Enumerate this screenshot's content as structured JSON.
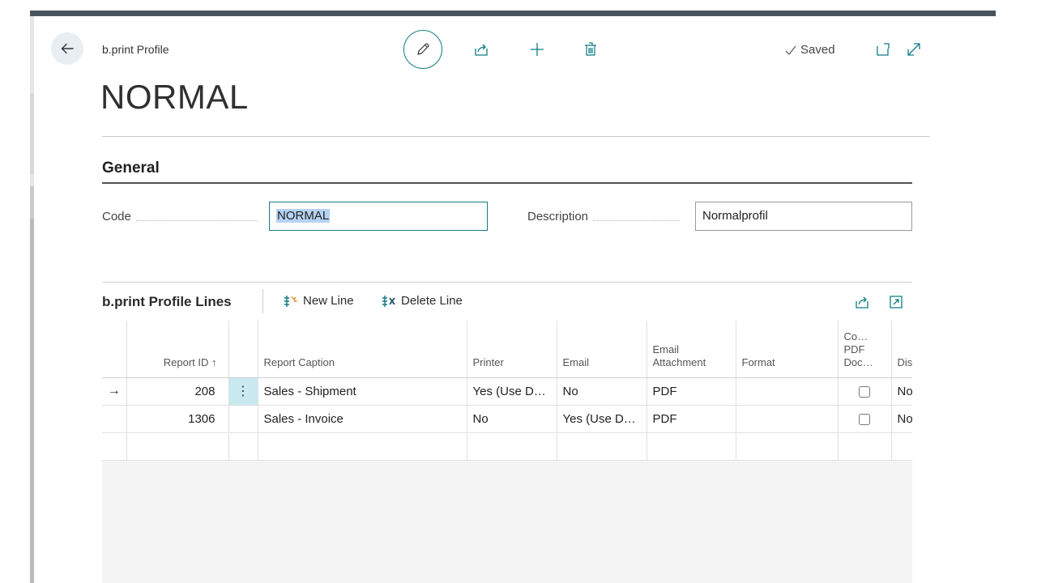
{
  "header": {
    "breadcrumb": "b.print Profile",
    "title": "NORMAL",
    "saved_label": "Saved",
    "icons": [
      "back-arrow-icon",
      "pencil-icon",
      "share-icon",
      "plus-icon",
      "trash-icon",
      "checkmark-icon",
      "open-new-window-icon",
      "expand-icon"
    ]
  },
  "general": {
    "section_title": "General",
    "code_label": "Code",
    "code_value": "NORMAL",
    "description_label": "Description",
    "description_value": "Normalprofil"
  },
  "lines": {
    "title": "b.print Profile Lines",
    "new_line_label": "New Line",
    "delete_line_label": "Delete Line",
    "columns": {
      "report_id": "Report ID ↑",
      "report_caption": "Report Caption",
      "printer": "Printer",
      "email": "Email",
      "email_attachment_1": "Email",
      "email_attachment_2": "Attachment",
      "format": "Format",
      "combine_1": "Co…",
      "combine_2": "PDF",
      "combine_3": "Doc…",
      "dis": "Dis"
    },
    "rows": [
      {
        "report_id": "208",
        "report_caption": "Sales - Shipment",
        "printer": "Yes (Use D…",
        "email": "No",
        "email_attachment": "PDF",
        "format": "",
        "combine_checked": false,
        "dis": "No"
      },
      {
        "report_id": "1306",
        "report_caption": "Sales - Invoice",
        "printer": "No",
        "email": "Yes (Use D…",
        "email_attachment": "PDF",
        "format": "",
        "combine_checked": false,
        "dis": "No"
      }
    ]
  },
  "colors": {
    "accent": "#0e7c83",
    "selection": "#b6d2f2",
    "topbar": "#4a545c"
  }
}
